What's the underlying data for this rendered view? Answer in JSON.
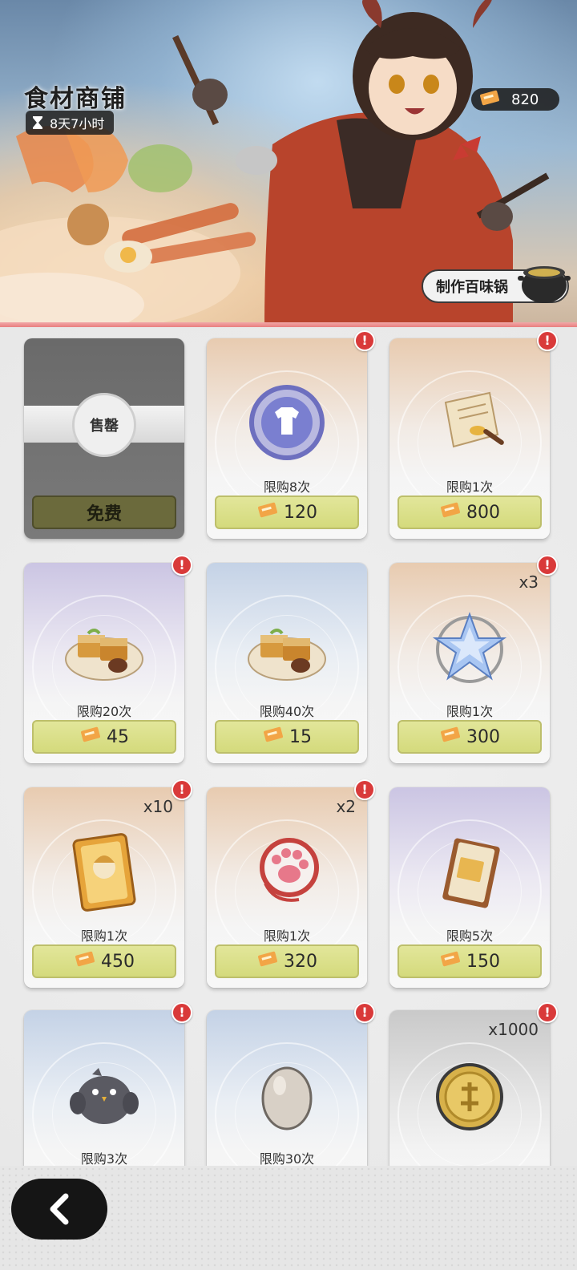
{
  "shop": {
    "title": "食材商铺",
    "timer": "8天7小时",
    "currency_amount": "820",
    "make_button": "制作百味锅"
  },
  "colors": {
    "accent_red_line": "#e97f7f",
    "price_button": "#d4da7c",
    "free_button": "#6b6a3c",
    "alert_badge": "#d93a3a"
  },
  "items": [
    {
      "name": "sold-out",
      "sold_label": "售罄",
      "free_label": "免费",
      "alert": false
    },
    {
      "name": "outfit-coin",
      "icon": "shirt-coin-icon",
      "limit": "限购8次",
      "price": "120",
      "alert": true
    },
    {
      "name": "recipe-scroll",
      "icon": "recipe-scroll-icon",
      "limit": "限购1次",
      "price": "800",
      "alert": true
    },
    {
      "name": "tofu-dish-a",
      "icon": "tofu-dish-icon",
      "limit": "限购20次",
      "price": "45",
      "alert": true
    },
    {
      "name": "tofu-dish-b",
      "icon": "tofu-dish-icon",
      "limit": "限购40次",
      "price": "15",
      "alert": false
    },
    {
      "name": "crystal-star",
      "icon": "crystal-star-icon",
      "qty": "x3",
      "limit": "限购1次",
      "price": "300",
      "alert": true
    },
    {
      "name": "character-card",
      "icon": "character-card-icon",
      "qty": "x10",
      "limit": "限购1次",
      "price": "450",
      "alert": true
    },
    {
      "name": "paw-charm",
      "icon": "paw-charm-icon",
      "qty": "x2",
      "limit": "限购1次",
      "price": "320",
      "alert": true
    },
    {
      "name": "book",
      "icon": "book-icon",
      "limit": "限购5次",
      "price": "150",
      "alert": false
    },
    {
      "name": "bird-plush",
      "icon": "bird-plush-icon",
      "limit": "限购3次",
      "alert": true
    },
    {
      "name": "egg",
      "icon": "egg-icon",
      "limit": "限购30次",
      "alert": true
    },
    {
      "name": "gold-coin",
      "icon": "gold-coin-icon",
      "qty": "x1000",
      "alert": true
    }
  ]
}
